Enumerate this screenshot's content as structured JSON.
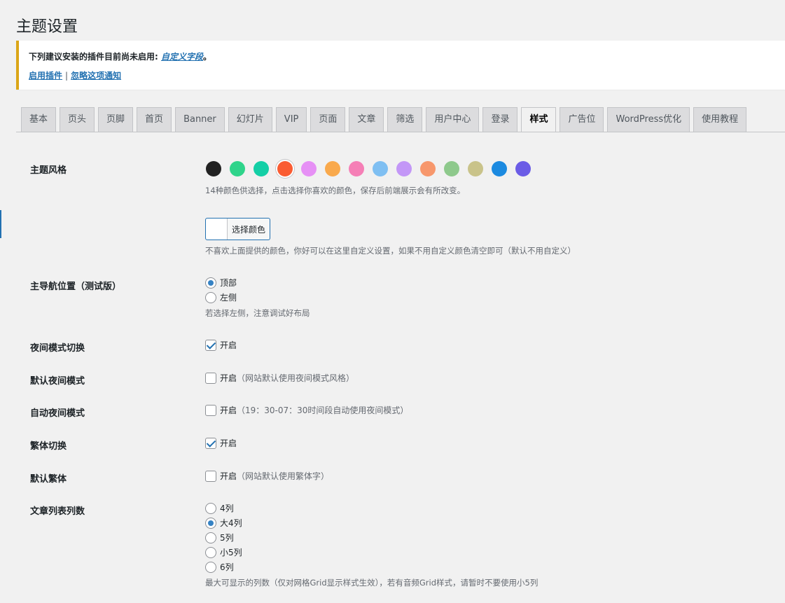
{
  "page": {
    "title": "主题设置"
  },
  "notice": {
    "text": "下列建议安装的插件目前尚未启用:",
    "plugin_link": "自定义字段",
    "period": "。",
    "activate_link": "启用插件",
    "separator": "|",
    "dismiss_link": "忽略这项通知"
  },
  "tabs": [
    {
      "label": "基本"
    },
    {
      "label": "页头"
    },
    {
      "label": "页脚"
    },
    {
      "label": "首页"
    },
    {
      "label": "Banner"
    },
    {
      "label": "幻灯片"
    },
    {
      "label": "VIP"
    },
    {
      "label": "页面"
    },
    {
      "label": "文章"
    },
    {
      "label": "筛选"
    },
    {
      "label": "用户中心"
    },
    {
      "label": "登录"
    },
    {
      "label": "样式",
      "active": true
    },
    {
      "label": "广告位"
    },
    {
      "label": "WordPress优化"
    },
    {
      "label": "使用教程"
    }
  ],
  "style_section": {
    "theme_style": {
      "label": "主题风格",
      "colors": [
        "#222222",
        "#2fd48b",
        "#14cfa6",
        "#fa5c32",
        "#e690f5",
        "#f9a94c",
        "#f57fb6",
        "#7fbff2",
        "#c397f7",
        "#f7976c",
        "#8ec98c",
        "#c9c38a",
        "#1c8ae0",
        "#6b5ce6"
      ],
      "selected_index": 3,
      "desc": "14种颜色供选择，点击选择你喜欢的颜色，保存后前端展示会有所改变。",
      "custom_button": "选择颜色",
      "custom_desc": "不喜欢上面提供的颜色，你好可以在这里自定义设置，如果不用自定义颜色清空即可（默认不用自定义）"
    },
    "nav_position": {
      "label": "主导航位置（测试版）",
      "options": [
        {
          "label": "顶部",
          "checked": true
        },
        {
          "label": "左侧",
          "checked": false
        }
      ],
      "desc": "若选择左侧，注意调试好布局"
    },
    "night_toggle": {
      "label": "夜间模式切换",
      "option": "开启",
      "checked": true,
      "hint": ""
    },
    "default_night": {
      "label": "默认夜间模式",
      "option": "开启",
      "checked": false,
      "hint": "（网站默认使用夜间模式风格）"
    },
    "auto_night": {
      "label": "自动夜间模式",
      "option": "开启",
      "checked": false,
      "hint": "（19：30-07：30时间段自动使用夜间模式）"
    },
    "traditional_toggle": {
      "label": "繁体切换",
      "option": "开启",
      "checked": true,
      "hint": ""
    },
    "default_traditional": {
      "label": "默认繁体",
      "option": "开启",
      "checked": false,
      "hint": "（网站默认使用繁体字）"
    },
    "list_columns": {
      "label": "文章列表列数",
      "options": [
        {
          "label": "4列",
          "checked": false
        },
        {
          "label": "大4列",
          "checked": true
        },
        {
          "label": "5列",
          "checked": false
        },
        {
          "label": "小5列",
          "checked": false
        },
        {
          "label": "6列",
          "checked": false
        }
      ],
      "desc": "最大可显示的列数（仅对网格Grid显示样式生效），若有音频Grid样式，请暂时不要使用小5列"
    }
  }
}
